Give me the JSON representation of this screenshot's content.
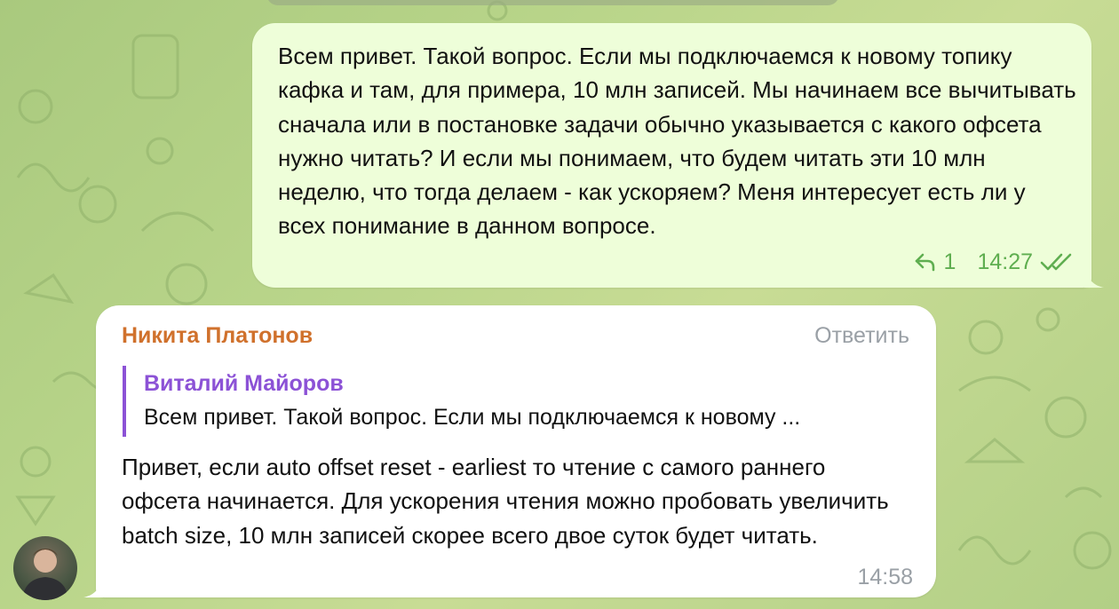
{
  "outgoing": {
    "text": "Всем привет. Такой вопрос. Если мы подключаемся к новому топику кафка и там, для примера, 10 млн записей. Мы начинаем все вычитывать сначала или в постановке задачи обычно указывается с какого офсета нужно читать? И если мы понимаем, что будем читать эти 10 млн неделю, что тогда делаем - как ускоряем? Меня интересует есть ли у всех понимание в данном вопросе.",
    "reply_count": "1",
    "time": "14:27",
    "reply_icon": "reply-arrow-icon",
    "status_icon": "double-check-icon"
  },
  "incoming": {
    "sender": "Никита Платонов",
    "reply_action": "Ответить",
    "quote": {
      "author": "Виталий Майоров",
      "text": "Всем привет. Такой вопрос. Если мы подключаемся к новому ..."
    },
    "text": "Привет, если auto offset reset - earliest то чтение с самого раннего офсета начинается. Для ускорения чтения можно пробовать увеличить batch size, 10 млн записей скорее всего двое суток будет читать.",
    "time": "14:58"
  },
  "colors": {
    "outgoing_bubble": "#eefed9",
    "incoming_bubble": "#ffffff",
    "sender_name": "#d0712c",
    "quote_accent": "#8c52d6",
    "meta_green": "#5fae50",
    "meta_gray": "#9aa0a6"
  }
}
